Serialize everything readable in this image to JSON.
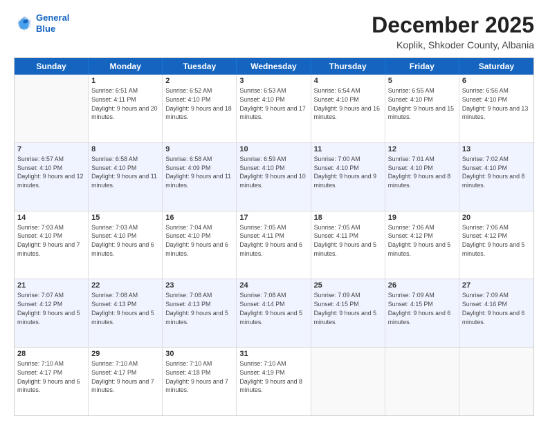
{
  "logo": {
    "line1": "General",
    "line2": "Blue"
  },
  "title": "December 2025",
  "location": "Koplik, Shkoder County, Albania",
  "weekdays": [
    "Sunday",
    "Monday",
    "Tuesday",
    "Wednesday",
    "Thursday",
    "Friday",
    "Saturday"
  ],
  "weeks": [
    [
      {
        "day": "",
        "sunrise": "",
        "sunset": "",
        "daylight": ""
      },
      {
        "day": "1",
        "sunrise": "6:51 AM",
        "sunset": "4:11 PM",
        "daylight": "9 hours and 20 minutes."
      },
      {
        "day": "2",
        "sunrise": "6:52 AM",
        "sunset": "4:10 PM",
        "daylight": "9 hours and 18 minutes."
      },
      {
        "day": "3",
        "sunrise": "6:53 AM",
        "sunset": "4:10 PM",
        "daylight": "9 hours and 17 minutes."
      },
      {
        "day": "4",
        "sunrise": "6:54 AM",
        "sunset": "4:10 PM",
        "daylight": "9 hours and 16 minutes."
      },
      {
        "day": "5",
        "sunrise": "6:55 AM",
        "sunset": "4:10 PM",
        "daylight": "9 hours and 15 minutes."
      },
      {
        "day": "6",
        "sunrise": "6:56 AM",
        "sunset": "4:10 PM",
        "daylight": "9 hours and 13 minutes."
      }
    ],
    [
      {
        "day": "7",
        "sunrise": "6:57 AM",
        "sunset": "4:10 PM",
        "daylight": "9 hours and 12 minutes."
      },
      {
        "day": "8",
        "sunrise": "6:58 AM",
        "sunset": "4:10 PM",
        "daylight": "9 hours and 11 minutes."
      },
      {
        "day": "9",
        "sunrise": "6:58 AM",
        "sunset": "4:09 PM",
        "daylight": "9 hours and 11 minutes."
      },
      {
        "day": "10",
        "sunrise": "6:59 AM",
        "sunset": "4:10 PM",
        "daylight": "9 hours and 10 minutes."
      },
      {
        "day": "11",
        "sunrise": "7:00 AM",
        "sunset": "4:10 PM",
        "daylight": "9 hours and 9 minutes."
      },
      {
        "day": "12",
        "sunrise": "7:01 AM",
        "sunset": "4:10 PM",
        "daylight": "9 hours and 8 minutes."
      },
      {
        "day": "13",
        "sunrise": "7:02 AM",
        "sunset": "4:10 PM",
        "daylight": "9 hours and 8 minutes."
      }
    ],
    [
      {
        "day": "14",
        "sunrise": "7:03 AM",
        "sunset": "4:10 PM",
        "daylight": "9 hours and 7 minutes."
      },
      {
        "day": "15",
        "sunrise": "7:03 AM",
        "sunset": "4:10 PM",
        "daylight": "9 hours and 6 minutes."
      },
      {
        "day": "16",
        "sunrise": "7:04 AM",
        "sunset": "4:10 PM",
        "daylight": "9 hours and 6 minutes."
      },
      {
        "day": "17",
        "sunrise": "7:05 AM",
        "sunset": "4:11 PM",
        "daylight": "9 hours and 6 minutes."
      },
      {
        "day": "18",
        "sunrise": "7:05 AM",
        "sunset": "4:11 PM",
        "daylight": "9 hours and 5 minutes."
      },
      {
        "day": "19",
        "sunrise": "7:06 AM",
        "sunset": "4:12 PM",
        "daylight": "9 hours and 5 minutes."
      },
      {
        "day": "20",
        "sunrise": "7:06 AM",
        "sunset": "4:12 PM",
        "daylight": "9 hours and 5 minutes."
      }
    ],
    [
      {
        "day": "21",
        "sunrise": "7:07 AM",
        "sunset": "4:12 PM",
        "daylight": "9 hours and 5 minutes."
      },
      {
        "day": "22",
        "sunrise": "7:08 AM",
        "sunset": "4:13 PM",
        "daylight": "9 hours and 5 minutes."
      },
      {
        "day": "23",
        "sunrise": "7:08 AM",
        "sunset": "4:13 PM",
        "daylight": "9 hours and 5 minutes."
      },
      {
        "day": "24",
        "sunrise": "7:08 AM",
        "sunset": "4:14 PM",
        "daylight": "9 hours and 5 minutes."
      },
      {
        "day": "25",
        "sunrise": "7:09 AM",
        "sunset": "4:15 PM",
        "daylight": "9 hours and 5 minutes."
      },
      {
        "day": "26",
        "sunrise": "7:09 AM",
        "sunset": "4:15 PM",
        "daylight": "9 hours and 6 minutes."
      },
      {
        "day": "27",
        "sunrise": "7:09 AM",
        "sunset": "4:16 PM",
        "daylight": "9 hours and 6 minutes."
      }
    ],
    [
      {
        "day": "28",
        "sunrise": "7:10 AM",
        "sunset": "4:17 PM",
        "daylight": "9 hours and 6 minutes."
      },
      {
        "day": "29",
        "sunrise": "7:10 AM",
        "sunset": "4:17 PM",
        "daylight": "9 hours and 7 minutes."
      },
      {
        "day": "30",
        "sunrise": "7:10 AM",
        "sunset": "4:18 PM",
        "daylight": "9 hours and 7 minutes."
      },
      {
        "day": "31",
        "sunrise": "7:10 AM",
        "sunset": "4:19 PM",
        "daylight": "9 hours and 8 minutes."
      },
      {
        "day": "",
        "sunrise": "",
        "sunset": "",
        "daylight": ""
      },
      {
        "day": "",
        "sunrise": "",
        "sunset": "",
        "daylight": ""
      },
      {
        "day": "",
        "sunrise": "",
        "sunset": "",
        "daylight": ""
      }
    ]
  ]
}
